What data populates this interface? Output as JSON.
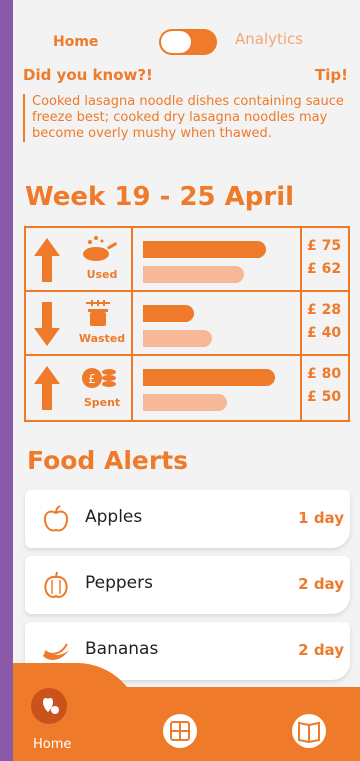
{
  "header": {
    "home_label": "Home",
    "analytics_label": "Analytics",
    "toggle_state": "home"
  },
  "tip": {
    "heading": "Did you know?!",
    "label": "Tip!",
    "text": "Cooked lasagna noodle dishes containing sauce freeze best; cooked dry lasagna noodles may become overly mushy when thawed."
  },
  "week": {
    "title": "Week 19 - 25 April"
  },
  "stats": [
    {
      "label": "Used",
      "direction": "up",
      "current": "£ 75",
      "previous": "£ 62",
      "current_ratio": 0.82,
      "previous_ratio": 0.67,
      "icon": "cooking-pan-icon"
    },
    {
      "label": "Wasted",
      "direction": "down",
      "current": "£ 28",
      "previous": "£ 40",
      "current_ratio": 0.34,
      "previous_ratio": 0.46,
      "icon": "fish-bone-bin-icon"
    },
    {
      "label": "Spent",
      "direction": "up",
      "current": "£ 80",
      "previous": "£ 50",
      "current_ratio": 0.88,
      "previous_ratio": 0.56,
      "icon": "coins-icon"
    }
  ],
  "alerts": {
    "title": "Food Alerts",
    "items": [
      {
        "name": "Apples",
        "days": "1 day",
        "icon": "apple-icon"
      },
      {
        "name": "Peppers",
        "days": "2 day",
        "icon": "pepper-icon"
      },
      {
        "name": "Bananas",
        "days": "2 day",
        "icon": "banana-icon"
      }
    ]
  },
  "nav": {
    "home_label": "Home",
    "items": [
      "home-icon",
      "grocery-store-icon",
      "recipe-book-icon"
    ]
  },
  "colors": {
    "accent": "#ee7a2a",
    "accent_light": "#f6b896",
    "accent_dark": "#c9531a",
    "background": "#f3f3f3"
  }
}
